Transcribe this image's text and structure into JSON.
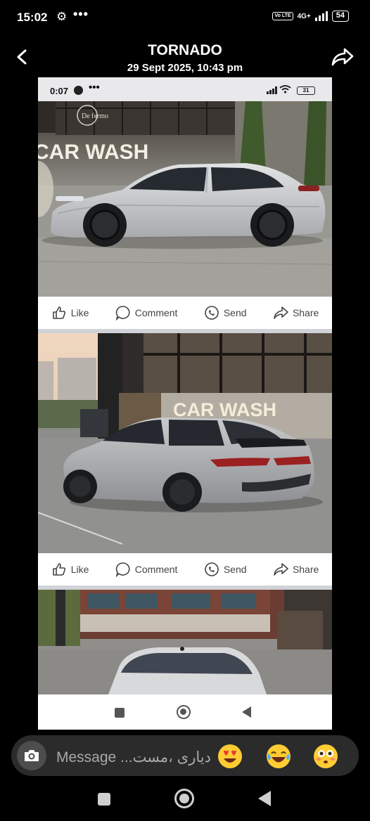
{
  "status_bar": {
    "time": "15:02",
    "settings_icon": "gear-icon",
    "more_indicator": "•••",
    "volte": "Vo LTE",
    "network": "4G+",
    "battery": "54"
  },
  "header": {
    "title": "TORNADO",
    "subtitle": "29 Sept 2025, 10:43 pm",
    "back_icon": "arrow-left-icon",
    "forward_icon": "share-forward-icon"
  },
  "inner_screenshot": {
    "status": {
      "time": "0:07",
      "more": "•••",
      "battery": "31"
    },
    "photos": [
      {
        "sign": "CAR WASH",
        "shop": "De fermo"
      },
      {
        "sign": "CAR WASH",
        "shop": ""
      },
      {
        "sign": "",
        "shop": ""
      }
    ],
    "actions": {
      "like": "Like",
      "comment": "Comment",
      "send": "Send",
      "share": "Share"
    }
  },
  "message_bar": {
    "placeholder": "Message ...دیاری ،مست",
    "camera_icon": "camera-icon",
    "emojis": [
      "heart-eyes-emoji-icon",
      "tears-of-joy-emoji-icon",
      "flushed-emoji-icon"
    ]
  },
  "colors": {
    "background": "#000000",
    "message_bar": "#2b2b2b",
    "emoji": "#ffcc33"
  }
}
